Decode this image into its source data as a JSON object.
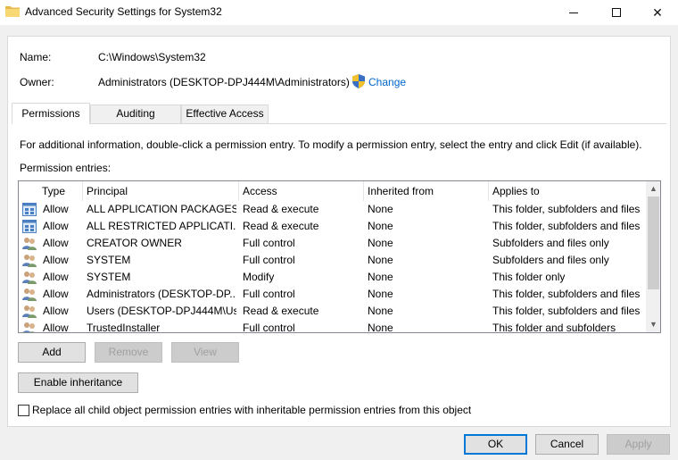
{
  "window": {
    "title": "Advanced Security Settings for System32",
    "minimize_icon": "minimize-icon",
    "maximize_icon": "maximize-icon",
    "close_glyph": "✕"
  },
  "info": {
    "name_label": "Name:",
    "name_value": "C:\\Windows\\System32",
    "owner_label": "Owner:",
    "owner_value": "Administrators (DESKTOP-DPJ444M\\Administrators)",
    "change_link": "Change"
  },
  "tabs": [
    {
      "label": "Permissions",
      "active": true
    },
    {
      "label": "Auditing",
      "active": false
    },
    {
      "label": "Effective Access",
      "active": false
    }
  ],
  "permissions": {
    "description": "For additional information, double-click a permission entry. To modify a permission entry, select the entry and click Edit (if available).",
    "entries_label": "Permission entries:",
    "columns": [
      "Type",
      "Principal",
      "Access",
      "Inherited from",
      "Applies to"
    ],
    "rows": [
      {
        "icon": "app-package-icon",
        "type": "Allow",
        "principal": "ALL APPLICATION PACKAGES",
        "access": "Read & execute",
        "inherited": "None",
        "applies": "This folder, subfolders and files"
      },
      {
        "icon": "app-package-icon",
        "type": "Allow",
        "principal": "ALL RESTRICTED APPLICATI...",
        "access": "Read & execute",
        "inherited": "None",
        "applies": "This folder, subfolders and files"
      },
      {
        "icon": "users-icon",
        "type": "Allow",
        "principal": "CREATOR OWNER",
        "access": "Full control",
        "inherited": "None",
        "applies": "Subfolders and files only"
      },
      {
        "icon": "users-icon",
        "type": "Allow",
        "principal": "SYSTEM",
        "access": "Full control",
        "inherited": "None",
        "applies": "Subfolders and files only"
      },
      {
        "icon": "users-icon",
        "type": "Allow",
        "principal": "SYSTEM",
        "access": "Modify",
        "inherited": "None",
        "applies": "This folder only"
      },
      {
        "icon": "users-icon",
        "type": "Allow",
        "principal": "Administrators (DESKTOP-DP...",
        "access": "Full control",
        "inherited": "None",
        "applies": "This folder, subfolders and files"
      },
      {
        "icon": "users-icon",
        "type": "Allow",
        "principal": "Users (DESKTOP-DPJ444M\\Us...",
        "access": "Read & execute",
        "inherited": "None",
        "applies": "This folder, subfolders and files"
      },
      {
        "icon": "users-icon",
        "type": "Allow",
        "principal": "TrustedInstaller",
        "access": "Full control",
        "inherited": "None",
        "applies": "This folder and subfolders"
      }
    ]
  },
  "buttons": {
    "add": "Add",
    "remove": "Remove",
    "view": "View",
    "enable_inheritance": "Enable inheritance",
    "replace_checkbox": "Replace all child object permission entries with inheritable permission entries from this object",
    "ok": "OK",
    "cancel": "Cancel",
    "apply": "Apply"
  },
  "colors": {
    "link": "#0066cc",
    "accent": "#0078d7",
    "folder": "#e8b94a"
  }
}
